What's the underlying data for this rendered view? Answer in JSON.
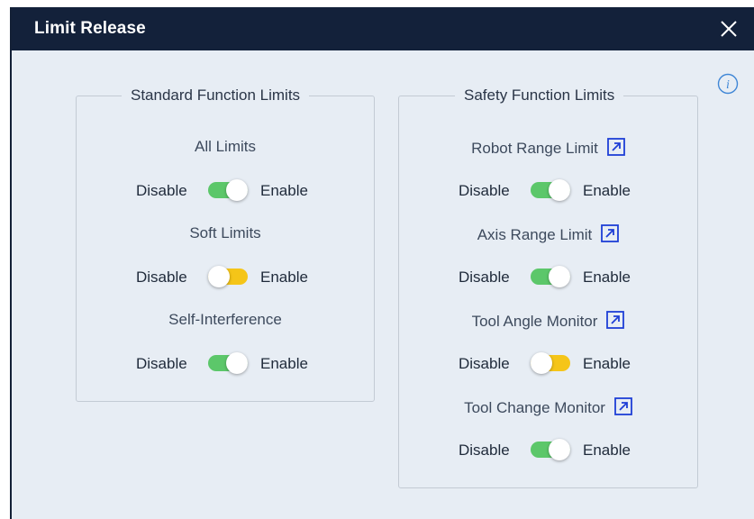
{
  "dialog": {
    "title": "Limit Release",
    "close_icon": "close-icon",
    "info_icon": "info-icon"
  },
  "colors": {
    "titlebar": "#13213a",
    "background": "#e7edf4",
    "toggle_on": "#5cc76a",
    "toggle_off": "#f5c518",
    "link_icon": "#1f3fd6"
  },
  "standard": {
    "title": "Standard Function Limits",
    "items": [
      {
        "label": "All Limits",
        "disable": "Disable",
        "enable": "Enable",
        "state": "on"
      },
      {
        "label": "Soft Limits",
        "disable": "Disable",
        "enable": "Enable",
        "state": "off"
      },
      {
        "label": "Self-Interference",
        "disable": "Disable",
        "enable": "Enable",
        "state": "on"
      }
    ]
  },
  "safety": {
    "title": "Safety Function Limits",
    "link_icon": "external-link-icon",
    "items": [
      {
        "label": "Robot Range Limit",
        "disable": "Disable",
        "enable": "Enable",
        "state": "on"
      },
      {
        "label": "Axis Range Limit",
        "disable": "Disable",
        "enable": "Enable",
        "state": "on"
      },
      {
        "label": "Tool Angle Monitor",
        "disable": "Disable",
        "enable": "Enable",
        "state": "off"
      },
      {
        "label": "Tool Change Monitor",
        "disable": "Disable",
        "enable": "Enable",
        "state": "on"
      }
    ]
  }
}
